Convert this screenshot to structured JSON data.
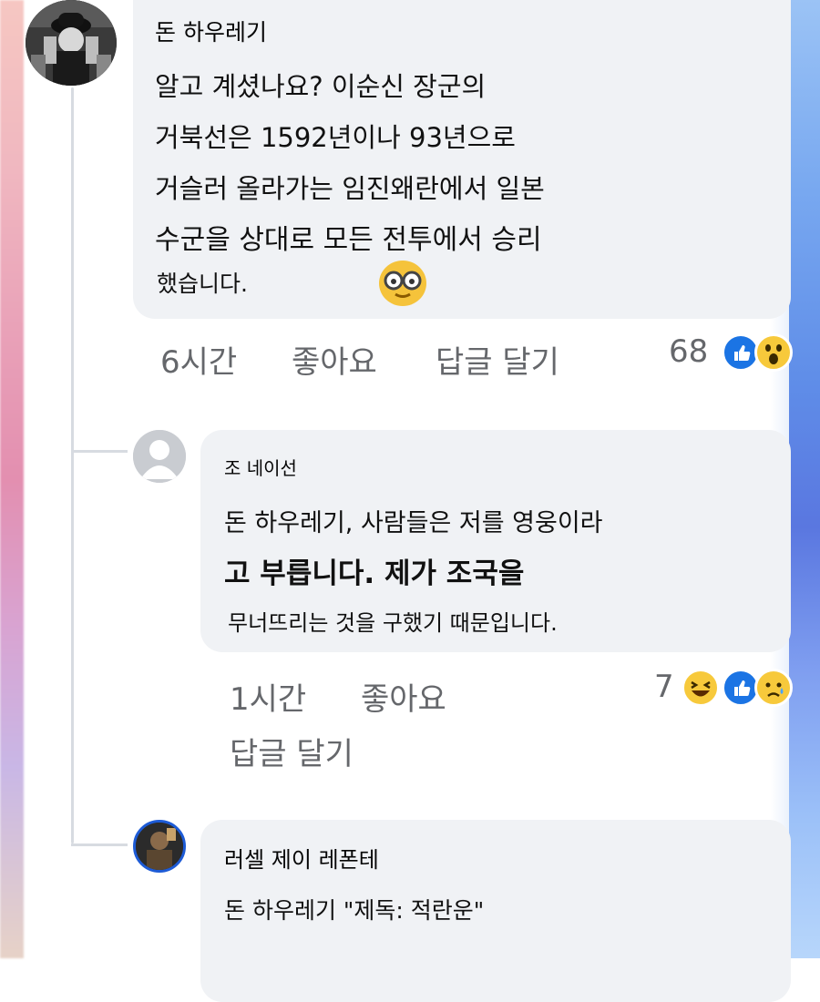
{
  "comment1": {
    "author": "돈 하우레기",
    "lines": [
      "알고 계셨나요? 이순신 장군의",
      "거북선은 1592년이나 93년으로",
      "거슬러 올라가는 임진왜란에서 일본",
      "수군을 상대로 모든 전투에서 승리",
      "했습니다."
    ],
    "time": "6시간",
    "like_label": "좋아요",
    "reply_label": "답글 달기",
    "reaction_count": "68",
    "reactions": [
      "like-icon",
      "wow-icon"
    ]
  },
  "comment2": {
    "author": "조 네이선",
    "lines": [
      "돈 하우레기, 사람들은 저를 영웅이라",
      "고 부릅니다. 제가 조국을",
      "무너뜨리는 것을 구했기 때문입니다."
    ],
    "time": "1시간",
    "like_label": "좋아요",
    "reply_label": "답글 달기",
    "reaction_count": "7",
    "reactions": [
      "haha-icon",
      "like-icon",
      "sad-icon"
    ]
  },
  "comment3": {
    "author": "러셀 제이 레폰테",
    "line": "돈 하우레기 \"제독: 적란운\""
  },
  "colors": {
    "bubble": "#f0f2f5",
    "meta": "#65676b",
    "like_blue": "#1b74e4",
    "emoji_yellow": "#f7c93b"
  }
}
